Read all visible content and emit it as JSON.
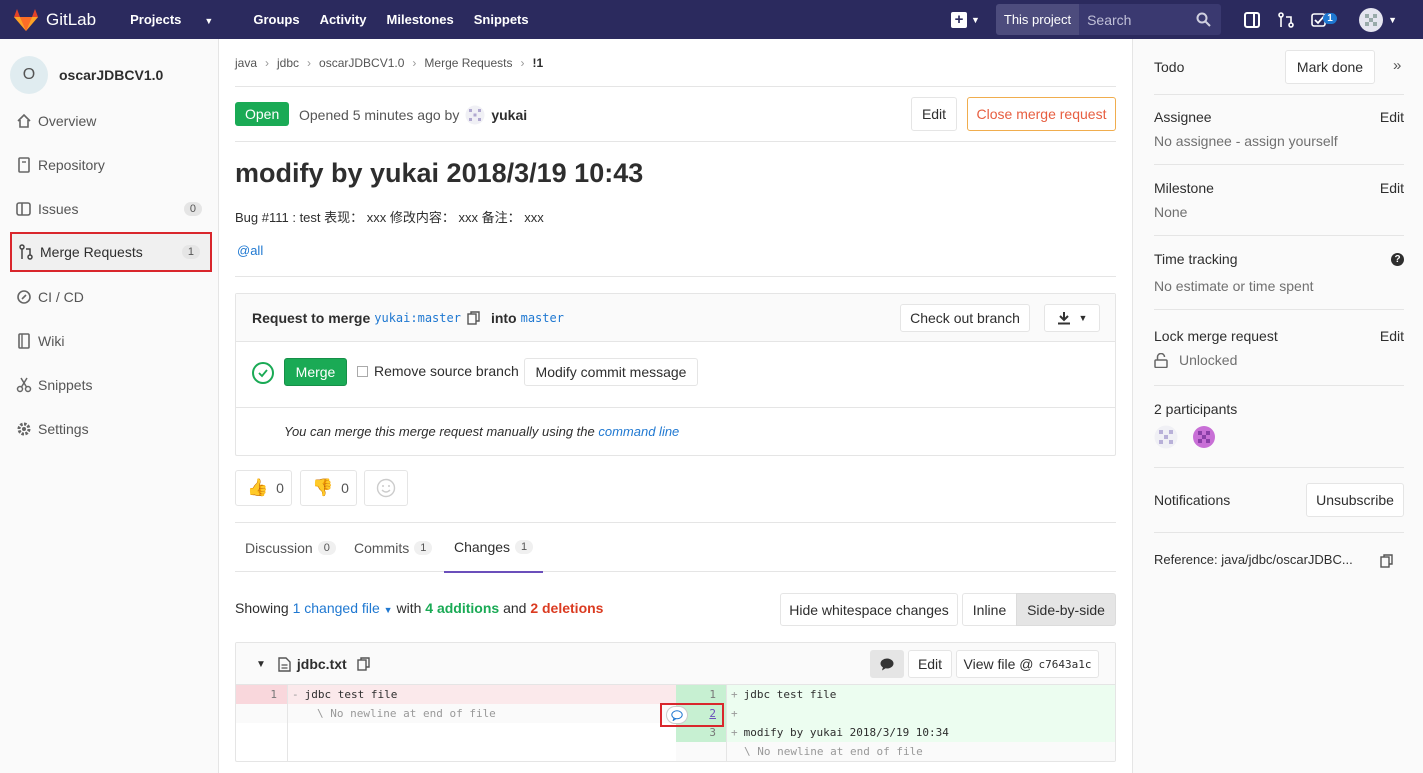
{
  "nav": {
    "brand": "GitLab",
    "links": [
      "Projects",
      "Groups",
      "Activity",
      "Milestones",
      "Snippets"
    ],
    "search_scope": "This project",
    "search_placeholder": "Search",
    "todo_count": "1"
  },
  "sidebar": {
    "project_initial": "O",
    "project_name": "oscarJDBCV1.0",
    "items": [
      {
        "label": "Overview",
        "icon": "home-icon"
      },
      {
        "label": "Repository",
        "icon": "doc-icon"
      },
      {
        "label": "Issues",
        "icon": "issues-icon",
        "count": "0"
      },
      {
        "label": "Merge Requests",
        "icon": "merge-request-icon",
        "count": "1"
      },
      {
        "label": "CI / CD",
        "icon": "rocket-icon"
      },
      {
        "label": "Wiki",
        "icon": "book-icon"
      },
      {
        "label": "Snippets",
        "icon": "scissors-icon"
      },
      {
        "label": "Settings",
        "icon": "gear-icon"
      }
    ]
  },
  "breadcrumb": [
    "java",
    "jdbc",
    "oscarJDBCV1.0",
    "Merge Requests",
    "!1"
  ],
  "mr": {
    "status": "Open",
    "opened_text": "Opened 5 minutes ago by",
    "author": "yukai",
    "edit_label": "Edit",
    "close_label": "Close merge request",
    "title": "modify by yukai 2018/3/19 10:43",
    "description": "Bug #111 : test 表现： xxx 修改内容： xxx 备注： xxx",
    "mention": "@all"
  },
  "widget": {
    "request_prefix": "Request to merge",
    "source_branch": "yukai:master",
    "into": "into",
    "target_branch": "master",
    "checkout_label": "Check out branch",
    "merge_label": "Merge",
    "remove_source_label": "Remove source branch",
    "modify_commit_label": "Modify commit message",
    "manual_text": "You can merge this merge request manually using the",
    "command_line": "command line"
  },
  "awards": {
    "thumbsup": "0",
    "thumbsdown": "0"
  },
  "tabs": [
    {
      "label": "Discussion",
      "count": "0"
    },
    {
      "label": "Commits",
      "count": "1"
    },
    {
      "label": "Changes",
      "count": "1"
    }
  ],
  "changes": {
    "showing": "Showing",
    "changed_file": "1 changed file",
    "with": "with",
    "additions": "4 additions",
    "and": "and",
    "deletions": "2 deletions",
    "hide_ws": "Hide whitespace changes",
    "inline": "Inline",
    "side_by_side": "Side-by-side"
  },
  "file": {
    "name": "jdbc.txt",
    "edit_label": "Edit",
    "view_file": "View file @",
    "sha": "c7643a1c",
    "left": [
      {
        "num": "1",
        "sign": "-",
        "text": "jdbc test file"
      },
      {
        "num": "",
        "sign": "",
        "text": "\\ No newline at end of file"
      }
    ],
    "right": [
      {
        "num": "1",
        "sign": "+",
        "text": "jdbc test file"
      },
      {
        "num": "2",
        "sign": "+",
        "text": ""
      },
      {
        "num": "3",
        "sign": "+",
        "text": "modify by yukai 2018/3/19 10:34"
      },
      {
        "num": "",
        "sign": "",
        "text": "\\ No newline at end of file"
      }
    ]
  },
  "right": {
    "todo": "Todo",
    "mark_done": "Mark done",
    "assignee": "Assignee",
    "assignee_edit": "Edit",
    "assignee_value": "No assignee - assign yourself",
    "milestone": "Milestone",
    "milestone_edit": "Edit",
    "milestone_value": "None",
    "time_tracking": "Time tracking",
    "time_value": "No estimate or time spent",
    "lock": "Lock merge request",
    "lock_edit": "Edit",
    "lock_value": "Unlocked",
    "participants": "2 participants",
    "notifications": "Notifications",
    "unsubscribe": "Unsubscribe",
    "reference": "Reference: java/jdbc/oscarJDBC..."
  },
  "colors": {
    "nav": "#2b2a5e",
    "green": "#1aaa55",
    "link": "#1f78d1",
    "red": "#db3b21",
    "highlight": "#d9262c"
  }
}
